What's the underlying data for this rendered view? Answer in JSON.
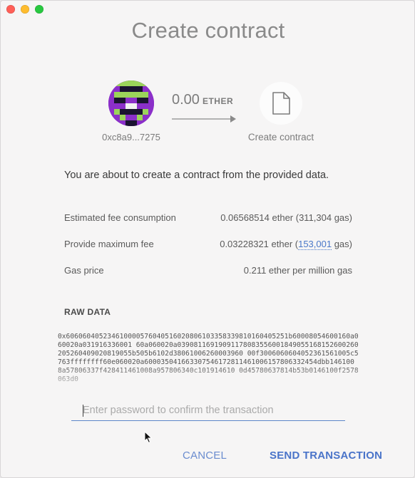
{
  "window": {
    "title": "Create contract"
  },
  "from": {
    "address": "0xc8a9...7275"
  },
  "amount": {
    "value": "0.00",
    "unit": "ETHER"
  },
  "to": {
    "label": "Create contract"
  },
  "message": "You are about to create a contract from the provided data.",
  "fees": {
    "estimated": {
      "label": "Estimated fee consumption",
      "value": "0.06568514 ether (311,304 gas)"
    },
    "maximum": {
      "label": "Provide maximum fee",
      "ether": "0.03228321 ether (",
      "gas": "153,001",
      "suffix": " gas)"
    },
    "gas_price": {
      "label": "Gas price",
      "value": "0.211 ether per million gas"
    }
  },
  "raw": {
    "label": "RAW DATA",
    "data": "0x606060405234610000576040516020806103358339810160405251b60008054600160a060020a031916336001 60a060020a03908116919091178083556001849055168152600260205260409020819055b505b6102d38061006260003960 00f3006060604052361561005c5763ffffffff60e060020a600035041663307546172811461006157806332454dbb146100 8a57806337f428411461008a957806340c101914610 0d45780637814b53b0146100f2578063d0"
  },
  "password": {
    "placeholder": "Enter password to confirm the transaction",
    "value": ""
  },
  "actions": {
    "cancel": "CANCEL",
    "send": "SEND TRANSACTION"
  }
}
